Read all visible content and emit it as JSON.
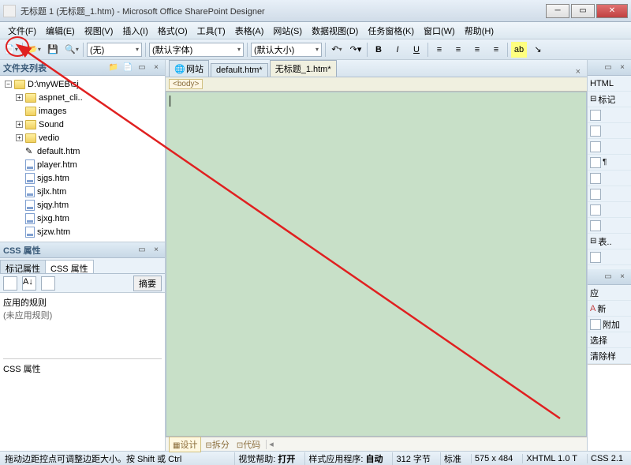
{
  "title": "无标题 1 (无标题_1.htm) - Microsoft Office SharePoint Designer",
  "menu": [
    "文件(F)",
    "编辑(E)",
    "视图(V)",
    "插入(I)",
    "格式(O)",
    "工具(T)",
    "表格(A)",
    "网站(S)",
    "数据视图(D)",
    "任务窗格(K)",
    "窗口(W)",
    "帮助(H)"
  ],
  "toolbar": {
    "style_sel": "(无)",
    "font_sel": "(默认字体)",
    "size_sel": "(默认大小)"
  },
  "folder_panel": {
    "title": "文件夹列表",
    "root": "D:\\myWEB\\sj",
    "folders": [
      "aspnet_cli..",
      "images",
      "Sound",
      "vedio"
    ],
    "files": [
      "default.htm",
      "player.htm",
      "sjgs.htm",
      "sjlx.htm",
      "sjqy.htm",
      "sjxg.htm",
      "sjzw.htm"
    ]
  },
  "css_panel": {
    "title": "CSS 属性",
    "tab1": "标记属性",
    "tab2": "CSS 属性",
    "summary_btn": "摘要",
    "rules_label": "应用的规则",
    "no_rules": "(未应用规则)",
    "props_label": "CSS 属性"
  },
  "doc_tabs": {
    "tab1": "网站",
    "tab2": "default.htm*",
    "tab3": "无标题_1.htm*"
  },
  "breadcrumb": "<body>",
  "view_tabs": {
    "design": "设计",
    "split": "拆分",
    "code": "代码"
  },
  "right": {
    "html": "HTML",
    "mark": "标记",
    "panel2": "表..",
    "apply_hdr": "应",
    "new": "新",
    "attach": "附加",
    "select": "选择",
    "clear": "清除样"
  },
  "status": {
    "hint": "拖动边距控点可调整边距大小。按 Shift 或 Ctrl",
    "vis": "视觉帮助:",
    "vis_v": "打开",
    "style": "样式应用程序:",
    "style_v": "自动",
    "bytes": "312 字节",
    "std": "标准",
    "dim": "575 x 484",
    "xhtml": "XHTML 1.0 T",
    "css": "CSS 2.1"
  }
}
